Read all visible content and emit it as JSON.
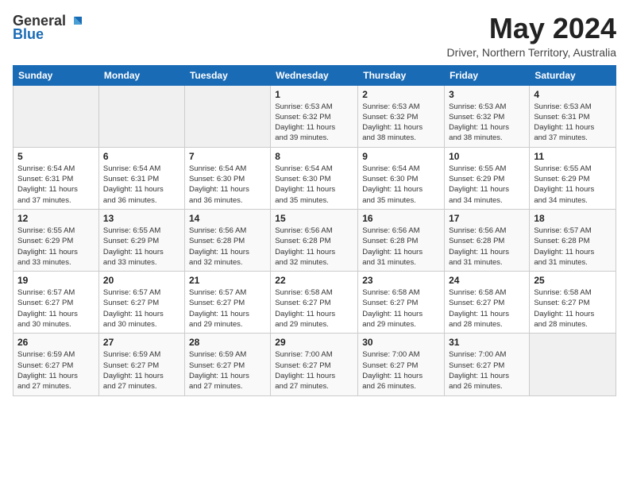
{
  "header": {
    "logo_general": "General",
    "logo_blue": "Blue",
    "month": "May 2024",
    "location": "Driver, Northern Territory, Australia"
  },
  "weekdays": [
    "Sunday",
    "Monday",
    "Tuesday",
    "Wednesday",
    "Thursday",
    "Friday",
    "Saturday"
  ],
  "weeks": [
    [
      {
        "day": "",
        "info": ""
      },
      {
        "day": "",
        "info": ""
      },
      {
        "day": "",
        "info": ""
      },
      {
        "day": "1",
        "info": "Sunrise: 6:53 AM\nSunset: 6:32 PM\nDaylight: 11 hours\nand 39 minutes."
      },
      {
        "day": "2",
        "info": "Sunrise: 6:53 AM\nSunset: 6:32 PM\nDaylight: 11 hours\nand 38 minutes."
      },
      {
        "day": "3",
        "info": "Sunrise: 6:53 AM\nSunset: 6:32 PM\nDaylight: 11 hours\nand 38 minutes."
      },
      {
        "day": "4",
        "info": "Sunrise: 6:53 AM\nSunset: 6:31 PM\nDaylight: 11 hours\nand 37 minutes."
      }
    ],
    [
      {
        "day": "5",
        "info": "Sunrise: 6:54 AM\nSunset: 6:31 PM\nDaylight: 11 hours\nand 37 minutes."
      },
      {
        "day": "6",
        "info": "Sunrise: 6:54 AM\nSunset: 6:31 PM\nDaylight: 11 hours\nand 36 minutes."
      },
      {
        "day": "7",
        "info": "Sunrise: 6:54 AM\nSunset: 6:30 PM\nDaylight: 11 hours\nand 36 minutes."
      },
      {
        "day": "8",
        "info": "Sunrise: 6:54 AM\nSunset: 6:30 PM\nDaylight: 11 hours\nand 35 minutes."
      },
      {
        "day": "9",
        "info": "Sunrise: 6:54 AM\nSunset: 6:30 PM\nDaylight: 11 hours\nand 35 minutes."
      },
      {
        "day": "10",
        "info": "Sunrise: 6:55 AM\nSunset: 6:29 PM\nDaylight: 11 hours\nand 34 minutes."
      },
      {
        "day": "11",
        "info": "Sunrise: 6:55 AM\nSunset: 6:29 PM\nDaylight: 11 hours\nand 34 minutes."
      }
    ],
    [
      {
        "day": "12",
        "info": "Sunrise: 6:55 AM\nSunset: 6:29 PM\nDaylight: 11 hours\nand 33 minutes."
      },
      {
        "day": "13",
        "info": "Sunrise: 6:55 AM\nSunset: 6:29 PM\nDaylight: 11 hours\nand 33 minutes."
      },
      {
        "day": "14",
        "info": "Sunrise: 6:56 AM\nSunset: 6:28 PM\nDaylight: 11 hours\nand 32 minutes."
      },
      {
        "day": "15",
        "info": "Sunrise: 6:56 AM\nSunset: 6:28 PM\nDaylight: 11 hours\nand 32 minutes."
      },
      {
        "day": "16",
        "info": "Sunrise: 6:56 AM\nSunset: 6:28 PM\nDaylight: 11 hours\nand 31 minutes."
      },
      {
        "day": "17",
        "info": "Sunrise: 6:56 AM\nSunset: 6:28 PM\nDaylight: 11 hours\nand 31 minutes."
      },
      {
        "day": "18",
        "info": "Sunrise: 6:57 AM\nSunset: 6:28 PM\nDaylight: 11 hours\nand 31 minutes."
      }
    ],
    [
      {
        "day": "19",
        "info": "Sunrise: 6:57 AM\nSunset: 6:27 PM\nDaylight: 11 hours\nand 30 minutes."
      },
      {
        "day": "20",
        "info": "Sunrise: 6:57 AM\nSunset: 6:27 PM\nDaylight: 11 hours\nand 30 minutes."
      },
      {
        "day": "21",
        "info": "Sunrise: 6:57 AM\nSunset: 6:27 PM\nDaylight: 11 hours\nand 29 minutes."
      },
      {
        "day": "22",
        "info": "Sunrise: 6:58 AM\nSunset: 6:27 PM\nDaylight: 11 hours\nand 29 minutes."
      },
      {
        "day": "23",
        "info": "Sunrise: 6:58 AM\nSunset: 6:27 PM\nDaylight: 11 hours\nand 29 minutes."
      },
      {
        "day": "24",
        "info": "Sunrise: 6:58 AM\nSunset: 6:27 PM\nDaylight: 11 hours\nand 28 minutes."
      },
      {
        "day": "25",
        "info": "Sunrise: 6:58 AM\nSunset: 6:27 PM\nDaylight: 11 hours\nand 28 minutes."
      }
    ],
    [
      {
        "day": "26",
        "info": "Sunrise: 6:59 AM\nSunset: 6:27 PM\nDaylight: 11 hours\nand 27 minutes."
      },
      {
        "day": "27",
        "info": "Sunrise: 6:59 AM\nSunset: 6:27 PM\nDaylight: 11 hours\nand 27 minutes."
      },
      {
        "day": "28",
        "info": "Sunrise: 6:59 AM\nSunset: 6:27 PM\nDaylight: 11 hours\nand 27 minutes."
      },
      {
        "day": "29",
        "info": "Sunrise: 7:00 AM\nSunset: 6:27 PM\nDaylight: 11 hours\nand 27 minutes."
      },
      {
        "day": "30",
        "info": "Sunrise: 7:00 AM\nSunset: 6:27 PM\nDaylight: 11 hours\nand 26 minutes."
      },
      {
        "day": "31",
        "info": "Sunrise: 7:00 AM\nSunset: 6:27 PM\nDaylight: 11 hours\nand 26 minutes."
      },
      {
        "day": "",
        "info": ""
      }
    ]
  ]
}
